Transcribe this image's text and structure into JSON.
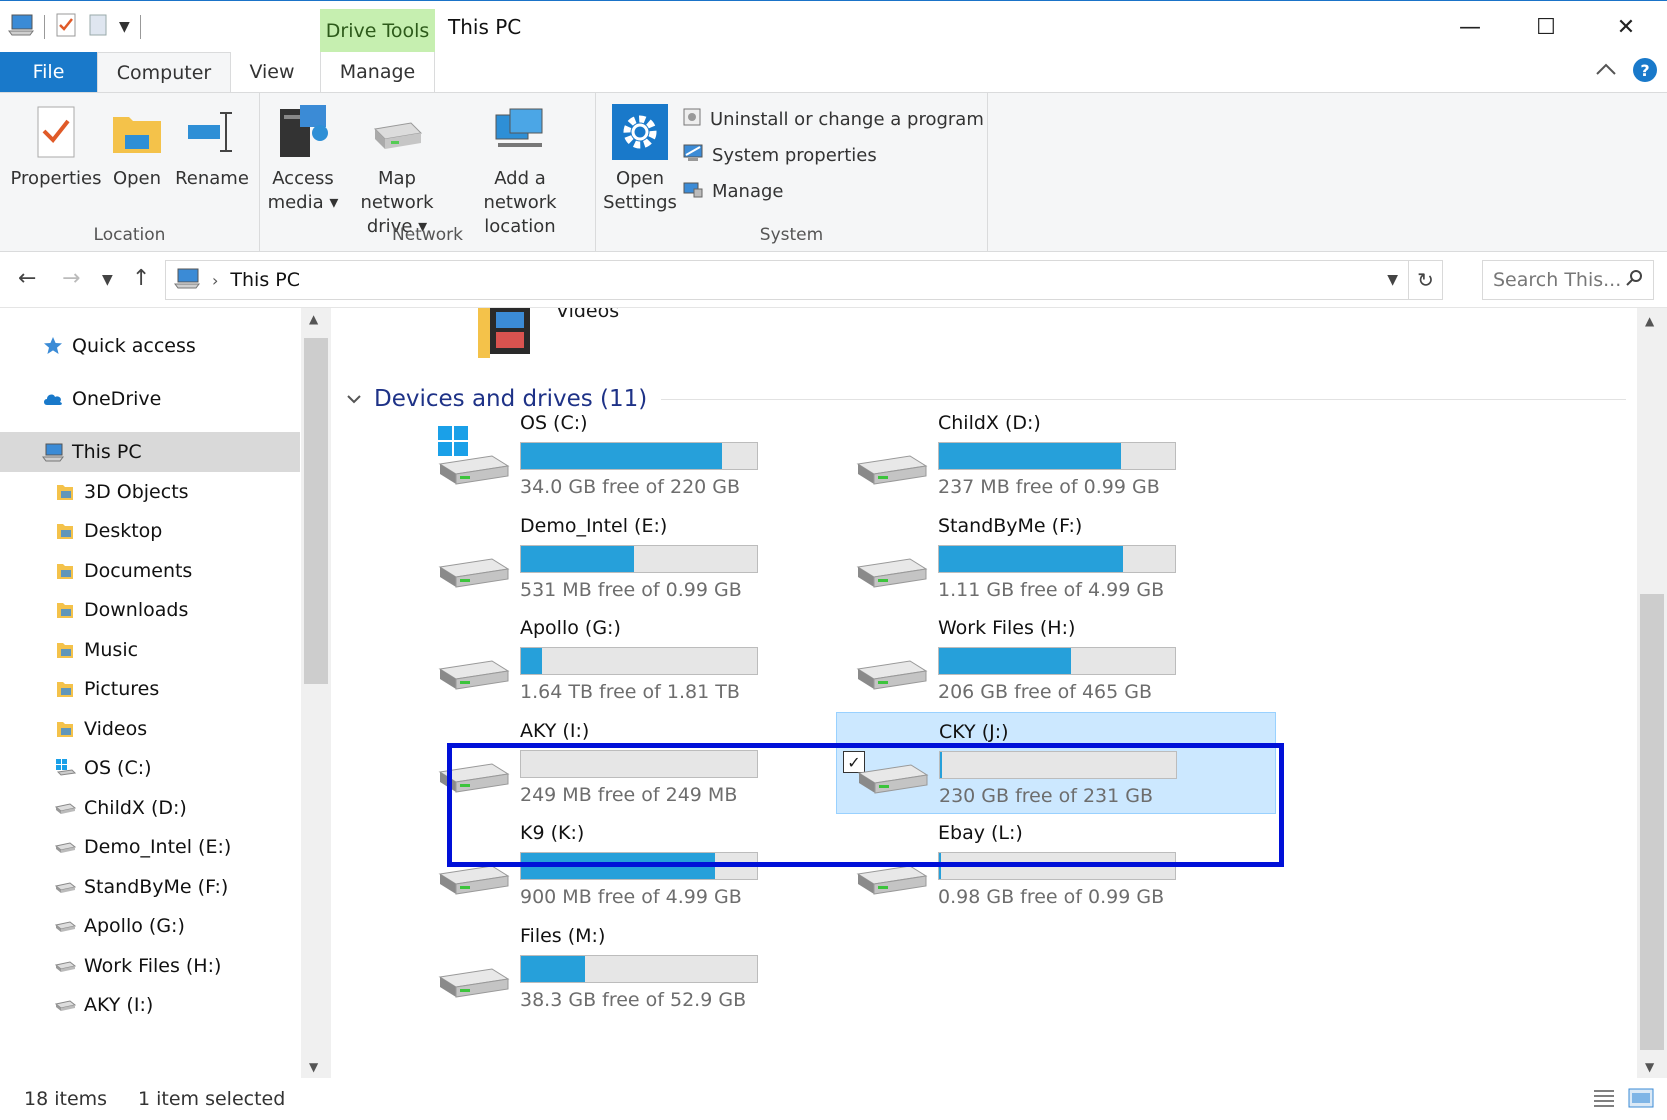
{
  "window": {
    "title": "This PC",
    "contextual_tab_group": "Drive Tools",
    "controls": {
      "minimize": "—",
      "maximize": "☐",
      "close": "✕"
    }
  },
  "ribbon": {
    "tabs": [
      "File",
      "Computer",
      "View",
      "Manage"
    ],
    "help_label": "?",
    "groups": {
      "location": {
        "label": "Location",
        "buttons": [
          "Properties",
          "Open",
          "Rename"
        ]
      },
      "network": {
        "label": "Network",
        "buttons": [
          {
            "line1": "Access",
            "line2": "media ▾"
          },
          {
            "line1": "Map network",
            "line2": "drive ▾"
          },
          {
            "line1": "Add a network",
            "line2": "location"
          }
        ]
      },
      "system": {
        "label": "System",
        "open_settings": {
          "line1": "Open",
          "line2": "Settings"
        },
        "small_buttons": [
          "Uninstall or change a program",
          "System properties",
          "Manage"
        ]
      }
    }
  },
  "address": {
    "path": "This PC",
    "search_placeholder": "Search This..."
  },
  "nav": {
    "items": [
      {
        "label": "Quick access",
        "icon": "star-icon",
        "level": 0
      },
      {
        "label": "OneDrive",
        "icon": "cloud-icon",
        "level": 0
      },
      {
        "label": "This PC",
        "icon": "computer-icon",
        "level": 0,
        "selected": true
      },
      {
        "label": "3D Objects",
        "icon": "folder-icon",
        "level": 1
      },
      {
        "label": "Desktop",
        "icon": "folder-icon",
        "level": 1
      },
      {
        "label": "Documents",
        "icon": "folder-icon",
        "level": 1
      },
      {
        "label": "Downloads",
        "icon": "folder-icon",
        "level": 1
      },
      {
        "label": "Music",
        "icon": "folder-icon",
        "level": 1
      },
      {
        "label": "Pictures",
        "icon": "folder-icon",
        "level": 1
      },
      {
        "label": "Videos",
        "icon": "folder-icon",
        "level": 1
      },
      {
        "label": "OS (C:)",
        "icon": "windows-drive-icon",
        "level": 1
      },
      {
        "label": "ChildX (D:)",
        "icon": "drive-icon",
        "level": 1
      },
      {
        "label": "Demo_Intel (E:)",
        "icon": "drive-icon",
        "level": 1
      },
      {
        "label": "StandByMe (F:)",
        "icon": "drive-icon",
        "level": 1
      },
      {
        "label": "Apollo (G:)",
        "icon": "drive-icon",
        "level": 1
      },
      {
        "label": "Work Files (H:)",
        "icon": "drive-icon",
        "level": 1
      },
      {
        "label": "AKY (I:)",
        "icon": "drive-icon",
        "level": 1
      }
    ]
  },
  "content": {
    "partial_folder_label": "Videos",
    "section_title": "Devices and drives (11)",
    "drives": [
      {
        "name": "OS (C:)",
        "free": "34.0 GB free of 220 GB",
        "used_fraction": 0.85,
        "windows": true
      },
      {
        "name": "ChildX (D:)",
        "free": "237 MB free of 0.99 GB",
        "used_fraction": 0.77
      },
      {
        "name": "Demo_Intel (E:)",
        "free": "531 MB free of 0.99 GB",
        "used_fraction": 0.48
      },
      {
        "name": "StandByMe (F:)",
        "free": "1.11 GB free of 4.99 GB",
        "used_fraction": 0.78
      },
      {
        "name": "Apollo (G:)",
        "free": "1.64 TB free of 1.81 TB",
        "used_fraction": 0.09
      },
      {
        "name": "Work Files (H:)",
        "free": "206 GB free of 465 GB",
        "used_fraction": 0.56
      },
      {
        "name": "AKY (I:)",
        "free": "249 MB free of 249 MB",
        "used_fraction": 0.0
      },
      {
        "name": "CKY (J:)",
        "free": "230 GB free of 231 GB",
        "used_fraction": 0.01,
        "selected": true
      },
      {
        "name": "K9 (K:)",
        "free": "900 MB free of 4.99 GB",
        "used_fraction": 0.82
      },
      {
        "name": "Ebay (L:)",
        "free": "0.98 GB free of 0.99 GB",
        "used_fraction": 0.01
      },
      {
        "name": "Files (M:)",
        "free": "38.3 GB free of 52.9 GB",
        "used_fraction": 0.27
      }
    ]
  },
  "status": {
    "item_count": "18 items",
    "selection": "1 item selected"
  },
  "colors": {
    "accent": "#1979ca",
    "bar_fill": "#26a0da",
    "selection_bg": "#cce8ff",
    "annotation_box": "#0010d8",
    "section_title": "#1e3287"
  }
}
